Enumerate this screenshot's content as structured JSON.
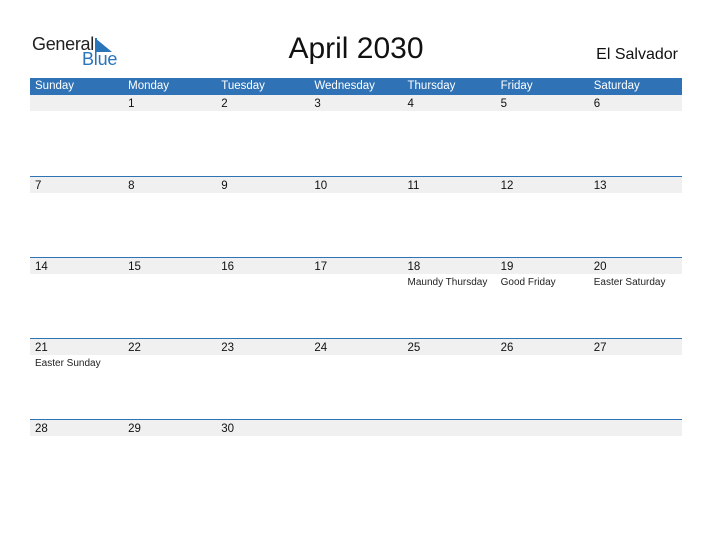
{
  "logo": {
    "word1": "General",
    "word2": "Blue"
  },
  "title": "April 2030",
  "country": "El Salvador",
  "weekdays": [
    "Sunday",
    "Monday",
    "Tuesday",
    "Wednesday",
    "Thursday",
    "Friday",
    "Saturday"
  ],
  "weeks": [
    [
      {
        "d": ""
      },
      {
        "d": "1"
      },
      {
        "d": "2"
      },
      {
        "d": "3"
      },
      {
        "d": "4"
      },
      {
        "d": "5"
      },
      {
        "d": "6"
      }
    ],
    [
      {
        "d": "7"
      },
      {
        "d": "8"
      },
      {
        "d": "9"
      },
      {
        "d": "10"
      },
      {
        "d": "11"
      },
      {
        "d": "12"
      },
      {
        "d": "13"
      }
    ],
    [
      {
        "d": "14"
      },
      {
        "d": "15"
      },
      {
        "d": "16"
      },
      {
        "d": "17"
      },
      {
        "d": "18",
        "h": "Maundy Thursday"
      },
      {
        "d": "19",
        "h": "Good Friday"
      },
      {
        "d": "20",
        "h": "Easter Saturday"
      }
    ],
    [
      {
        "d": "21",
        "h": "Easter Sunday"
      },
      {
        "d": "22"
      },
      {
        "d": "23"
      },
      {
        "d": "24"
      },
      {
        "d": "25"
      },
      {
        "d": "26"
      },
      {
        "d": "27"
      }
    ],
    [
      {
        "d": "28"
      },
      {
        "d": "29"
      },
      {
        "d": "30"
      },
      {
        "d": ""
      },
      {
        "d": ""
      },
      {
        "d": ""
      },
      {
        "d": ""
      }
    ]
  ]
}
